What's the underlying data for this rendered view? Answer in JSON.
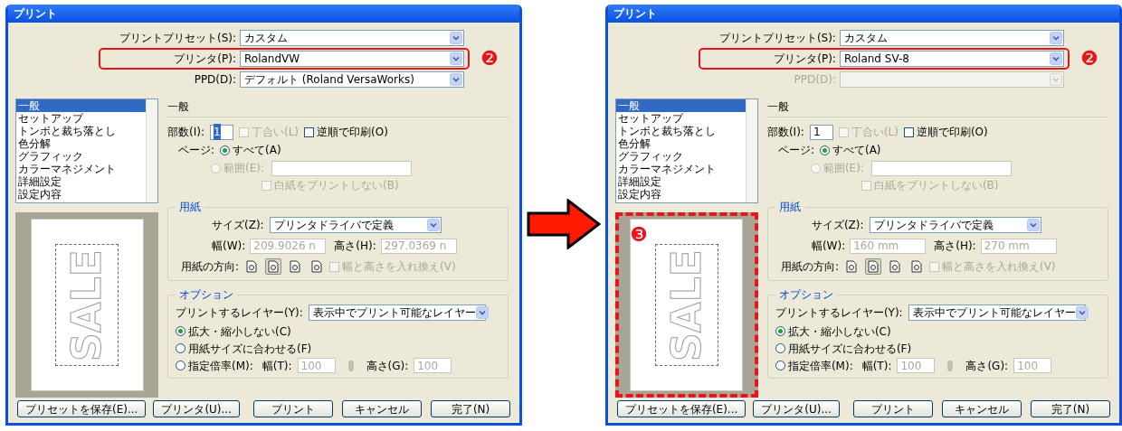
{
  "dialogs": [
    {
      "title": "プリント",
      "preset": {
        "label": "プリントプリセット(S):",
        "value": "カスタム"
      },
      "printer": {
        "label": "プリンタ(P):",
        "value": "RolandVW",
        "highlighted": true,
        "badge": "❷"
      },
      "ppd": {
        "label": "PPD(D):",
        "value": "デフォルト (Roland VersaWorks)",
        "disabled": false
      },
      "sidebar": {
        "items": [
          {
            "label": "一般",
            "selected": true
          },
          {
            "label": "セットアップ",
            "selected": false
          },
          {
            "label": "トンボと裁ち落とし",
            "selected": false
          },
          {
            "label": "色分解",
            "selected": false
          },
          {
            "label": "グラフィック",
            "selected": false
          },
          {
            "label": "カラーマネジメント",
            "selected": false
          },
          {
            "label": "詳細設定",
            "selected": false
          },
          {
            "label": "設定内容",
            "selected": false
          }
        ]
      },
      "general": {
        "heading": "一般",
        "copies_label": "部数(I):",
        "copies_value": "1",
        "copies_selected": true,
        "collate": {
          "label": "丁合い(L)",
          "checked": false,
          "disabled": true
        },
        "reverse": {
          "label": "逆順で印刷(O)",
          "checked": false,
          "disabled": false
        },
        "pages_label": "ページ:",
        "all_pages": {
          "label": "すべて(A)",
          "selected": true,
          "disabled": false
        },
        "range": {
          "label": "範囲(E):",
          "selected": false,
          "disabled": true
        },
        "skip_blank": {
          "label": "白紙をプリントしない(B)",
          "checked": false,
          "disabled": true
        }
      },
      "paper": {
        "heading": "用紙",
        "size_label": "サイズ(Z):",
        "size_value": "プリンタドライバで定義",
        "width_label": "幅(W):",
        "width_value": "209.9026 n",
        "height_label": "高さ(H):",
        "height_value": "297.0369 n",
        "orientation_label": "用紙の方向:",
        "orientations": [
          {
            "selected": false
          },
          {
            "selected": true
          },
          {
            "selected": false
          },
          {
            "selected": false
          }
        ],
        "transverse": {
          "label": "幅と高さを入れ換え(V)",
          "checked": false,
          "disabled": true
        }
      },
      "options": {
        "heading": "オプション",
        "layers_label": "プリントするレイヤー(Y):",
        "layers_value": "表示中でプリント可能なレイヤー",
        "scaling": [
          {
            "label": "拡大・縮小しない(C)",
            "selected": true,
            "disabled": false
          },
          {
            "label": "用紙サイズに合わせる(F)",
            "selected": false,
            "disabled": false
          },
          {
            "label": "指定倍率(M):",
            "selected": false,
            "disabled": false
          }
        ],
        "scale_width_label": "幅(T):",
        "scale_width_value": "100",
        "scale_height_label": "高さ(G):",
        "scale_height_value": "100"
      },
      "preview": {
        "text": "SALE",
        "highlighted": false
      },
      "buttons": [
        "プリセットを保存(E)...",
        "プリンタ(U)...",
        "プリント",
        "キャンセル",
        "完了(N)"
      ]
    },
    {
      "title": "プリント",
      "preset": {
        "label": "プリントプリセット(S):",
        "value": "カスタム"
      },
      "printer": {
        "label": "プリンタ(P):",
        "value": "Roland SV-8",
        "highlighted": true,
        "badge": "❷"
      },
      "ppd": {
        "label": "PPD(D):",
        "disabled": true
      },
      "sidebar": {
        "items": [
          {
            "label": "一般",
            "selected": true
          },
          {
            "label": "セットアップ",
            "selected": false
          },
          {
            "label": "トンボと裁ち落とし",
            "selected": false
          },
          {
            "label": "色分解",
            "selected": false
          },
          {
            "label": "グラフィック",
            "selected": false
          },
          {
            "label": "カラーマネジメント",
            "selected": false
          },
          {
            "label": "詳細設定",
            "selected": false
          },
          {
            "label": "設定内容",
            "selected": false
          }
        ]
      },
      "general": {
        "heading": "一般",
        "copies_label": "部数(I):",
        "copies_value": "1",
        "copies_selected": false,
        "collate": {
          "label": "丁合い(L)",
          "checked": false,
          "disabled": true
        },
        "reverse": {
          "label": "逆順で印刷(O)",
          "checked": false,
          "disabled": false
        },
        "pages_label": "ページ:",
        "all_pages": {
          "label": "すべて(A)",
          "selected": true,
          "disabled": false
        },
        "range": {
          "label": "範囲(E):",
          "selected": false,
          "disabled": true
        },
        "skip_blank": {
          "label": "白紙をプリントしない(B)",
          "checked": false,
          "disabled": true
        }
      },
      "paper": {
        "heading": "用紙",
        "size_label": "サイズ(Z):",
        "size_value": "プリンタドライバで定義",
        "width_label": "幅(W):",
        "width_value": "160 mm",
        "height_label": "高さ(H):",
        "height_value": "270 mm",
        "orientation_label": "用紙の方向:",
        "orientations": [
          {
            "selected": false
          },
          {
            "selected": true
          },
          {
            "selected": false
          },
          {
            "selected": false
          }
        ],
        "transverse": {
          "label": "幅と高さを入れ換え(V)",
          "checked": false,
          "disabled": true
        }
      },
      "options": {
        "heading": "オプション",
        "layers_label": "プリントするレイヤー(Y):",
        "layers_value": "表示中でプリント可能なレイヤー",
        "scaling": [
          {
            "label": "拡大・縮小しない(C)",
            "selected": true,
            "disabled": false
          },
          {
            "label": "用紙サイズに合わせる(F)",
            "selected": false,
            "disabled": false
          },
          {
            "label": "指定倍率(M):",
            "selected": false,
            "disabled": false
          }
        ],
        "scale_width_label": "幅(T):",
        "scale_width_value": "100",
        "scale_height_label": "高さ(G):",
        "scale_height_value": "100"
      },
      "preview": {
        "text": "SALE",
        "highlighted": true,
        "badge": "❸"
      },
      "buttons": [
        "プリセットを保存(E)...",
        "プリンタ(U)...",
        "プリント",
        "キャンセル",
        "完了(N)"
      ]
    }
  ]
}
